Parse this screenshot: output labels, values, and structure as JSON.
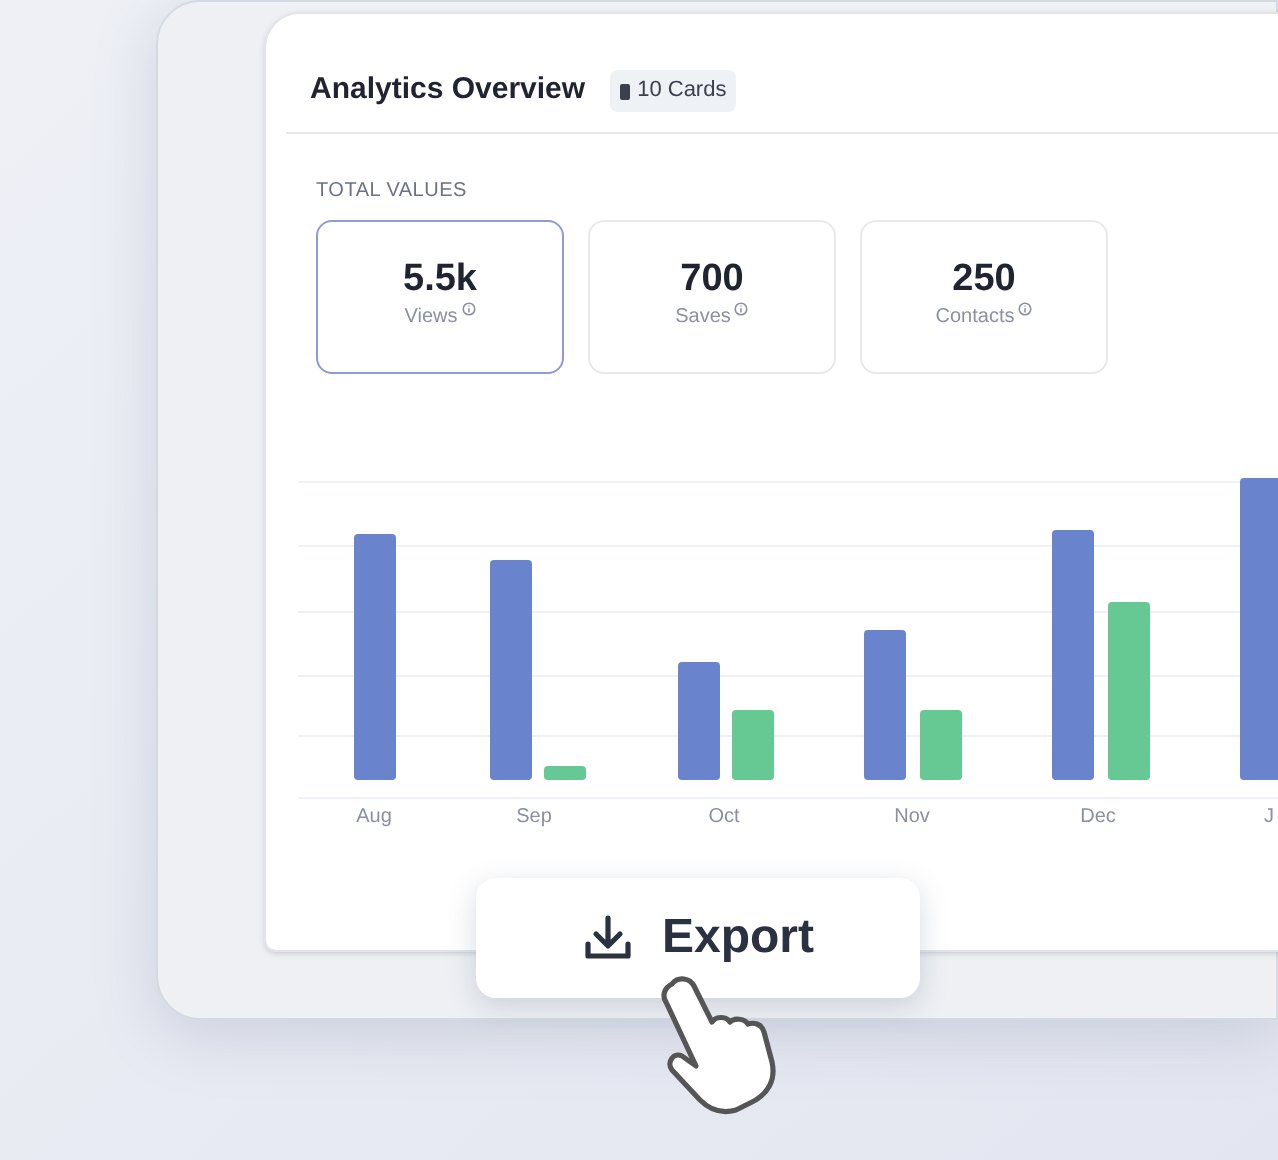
{
  "card": {
    "title": "Analytics Overview",
    "badge": "10 Cards"
  },
  "section_label": "TOTAL VALUES",
  "stats": [
    {
      "value": "5.5k",
      "label": "Views",
      "selected": true
    },
    {
      "value": "700",
      "label": "Saves",
      "selected": false
    },
    {
      "value": "250",
      "label": "Contacts",
      "selected": false
    }
  ],
  "chart": {
    "x_labels": [
      "Aug",
      "Sep",
      "Oct",
      "Nov",
      "Dec",
      "J"
    ]
  },
  "export_button": {
    "label": "Export"
  }
}
